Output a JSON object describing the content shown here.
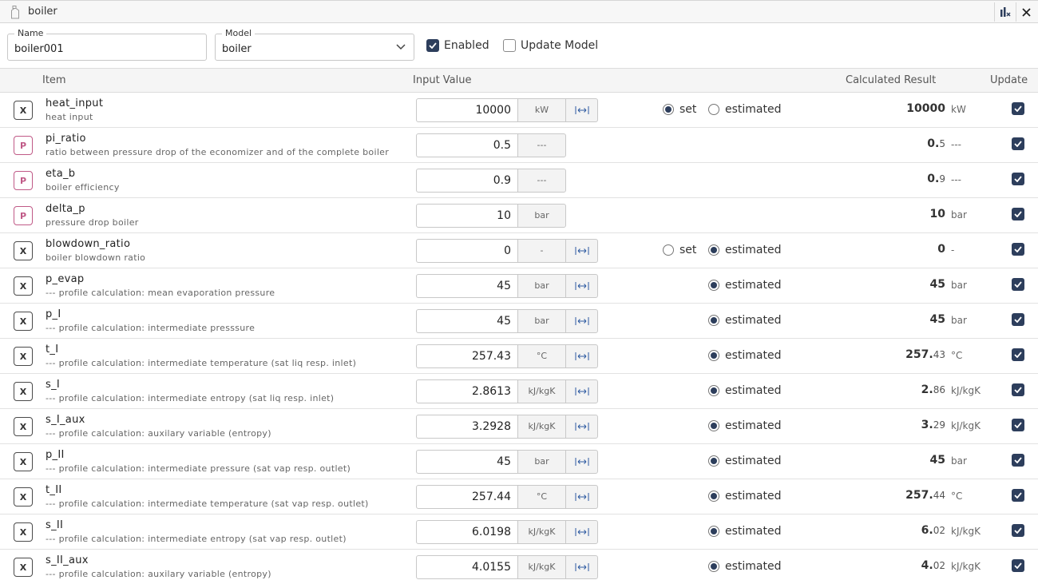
{
  "window": {
    "title": "boiler"
  },
  "form": {
    "name_label": "Name",
    "name_value": "boiler001",
    "model_label": "Model",
    "model_value": "boiler",
    "enabled_label": "Enabled",
    "enabled_checked": true,
    "update_model_label": "Update Model",
    "update_model_checked": false
  },
  "table": {
    "headers": {
      "item": "Item",
      "input_value": "Input Value",
      "calculated_result": "Calculated Result",
      "update": "Update"
    },
    "radio_set_label": "set",
    "radio_estimated_label": "estimated",
    "rows": [
      {
        "type": "X",
        "name": "heat_input",
        "desc": "heat input",
        "value": "10000",
        "unit": "kW",
        "swap": true,
        "set_option": true,
        "mode": "set",
        "res_int": "10000",
        "res_dec": "",
        "res_unit": "kW",
        "update": true
      },
      {
        "type": "P",
        "name": "pi_ratio",
        "desc": "ratio between pressure drop of the economizer and of the complete boiler",
        "value": "0.5",
        "unit": "---",
        "swap": false,
        "set_option": false,
        "mode": "",
        "res_int": "0.",
        "res_dec": "5",
        "res_unit": "---",
        "update": true
      },
      {
        "type": "P",
        "name": "eta_b",
        "desc": "boiler efficiency",
        "value": "0.9",
        "unit": "---",
        "swap": false,
        "set_option": false,
        "mode": "",
        "res_int": "0.",
        "res_dec": "9",
        "res_unit": "---",
        "update": true
      },
      {
        "type": "P",
        "name": "delta_p",
        "desc": "pressure drop boiler",
        "value": "10",
        "unit": "bar",
        "swap": false,
        "set_option": false,
        "mode": "",
        "res_int": "10",
        "res_dec": "",
        "res_unit": "bar",
        "update": true
      },
      {
        "type": "X",
        "name": "blowdown_ratio",
        "desc": "boiler blowdown ratio",
        "value": "0",
        "unit": "-",
        "swap": true,
        "set_option": true,
        "mode": "estimated",
        "res_int": "0",
        "res_dec": "",
        "res_unit": "-",
        "update": true
      },
      {
        "type": "X",
        "name": "p_evap",
        "desc": "--- profile calculation: mean evaporation pressure",
        "value": "45",
        "unit": "bar",
        "swap": true,
        "set_option": false,
        "mode": "estimated",
        "res_int": "45",
        "res_dec": "",
        "res_unit": "bar",
        "update": true
      },
      {
        "type": "X",
        "name": "p_I",
        "desc": "--- profile calculation: intermediate presssure",
        "value": "45",
        "unit": "bar",
        "swap": true,
        "set_option": false,
        "mode": "estimated",
        "res_int": "45",
        "res_dec": "",
        "res_unit": "bar",
        "update": true
      },
      {
        "type": "X",
        "name": "t_I",
        "desc": "--- profile calculation: intermediate temperature (sat liq resp. inlet)",
        "value": "257.43",
        "unit": "°C",
        "swap": true,
        "set_option": false,
        "mode": "estimated",
        "res_int": "257.",
        "res_dec": "43",
        "res_unit": "°C",
        "update": true
      },
      {
        "type": "X",
        "name": "s_I",
        "desc": "--- profile calculation: intermediate entropy (sat liq resp. inlet)",
        "value": "2.8613",
        "unit": "kJ/kgK",
        "swap": true,
        "set_option": false,
        "mode": "estimated",
        "res_int": "2.",
        "res_dec": "86",
        "res_unit": "kJ/kgK",
        "update": true
      },
      {
        "type": "X",
        "name": "s_I_aux",
        "desc": "--- profile calculation: auxilary variable (entropy)",
        "value": "3.2928",
        "unit": "kJ/kgK",
        "swap": true,
        "set_option": false,
        "mode": "estimated",
        "res_int": "3.",
        "res_dec": "29",
        "res_unit": "kJ/kgK",
        "update": true
      },
      {
        "type": "X",
        "name": "p_II",
        "desc": "--- profile calculation: intermediate pressure (sat vap resp. outlet)",
        "value": "45",
        "unit": "bar",
        "swap": true,
        "set_option": false,
        "mode": "estimated",
        "res_int": "45",
        "res_dec": "",
        "res_unit": "bar",
        "update": true
      },
      {
        "type": "X",
        "name": "t_II",
        "desc": "--- profile calculation: intermediate temperature (sat vap resp. outlet)",
        "value": "257.44",
        "unit": "°C",
        "swap": true,
        "set_option": false,
        "mode": "estimated",
        "res_int": "257.",
        "res_dec": "44",
        "res_unit": "°C",
        "update": true
      },
      {
        "type": "X",
        "name": "s_II",
        "desc": "--- profile calculation: intermediate entropy (sat vap resp. outlet)",
        "value": "6.0198",
        "unit": "kJ/kgK",
        "swap": true,
        "set_option": false,
        "mode": "estimated",
        "res_int": "6.",
        "res_dec": "02",
        "res_unit": "kJ/kgK",
        "update": true
      },
      {
        "type": "X",
        "name": "s_II_aux",
        "desc": "--- profile calculation: auxilary variable (entropy)",
        "value": "4.0155",
        "unit": "kJ/kgK",
        "swap": true,
        "set_option": false,
        "mode": "estimated",
        "res_int": "4.",
        "res_dec": "02",
        "res_unit": "kJ/kgK",
        "update": true
      }
    ]
  },
  "icons": {
    "app": "bottle-icon",
    "layout": "chart-icon",
    "close": "close-icon",
    "swap": "swap-icon",
    "dropdown": "chevron-down-icon",
    "check": "check-icon"
  },
  "colors": {
    "accent": "#2d3e5c",
    "parameter": "#c05a87"
  }
}
